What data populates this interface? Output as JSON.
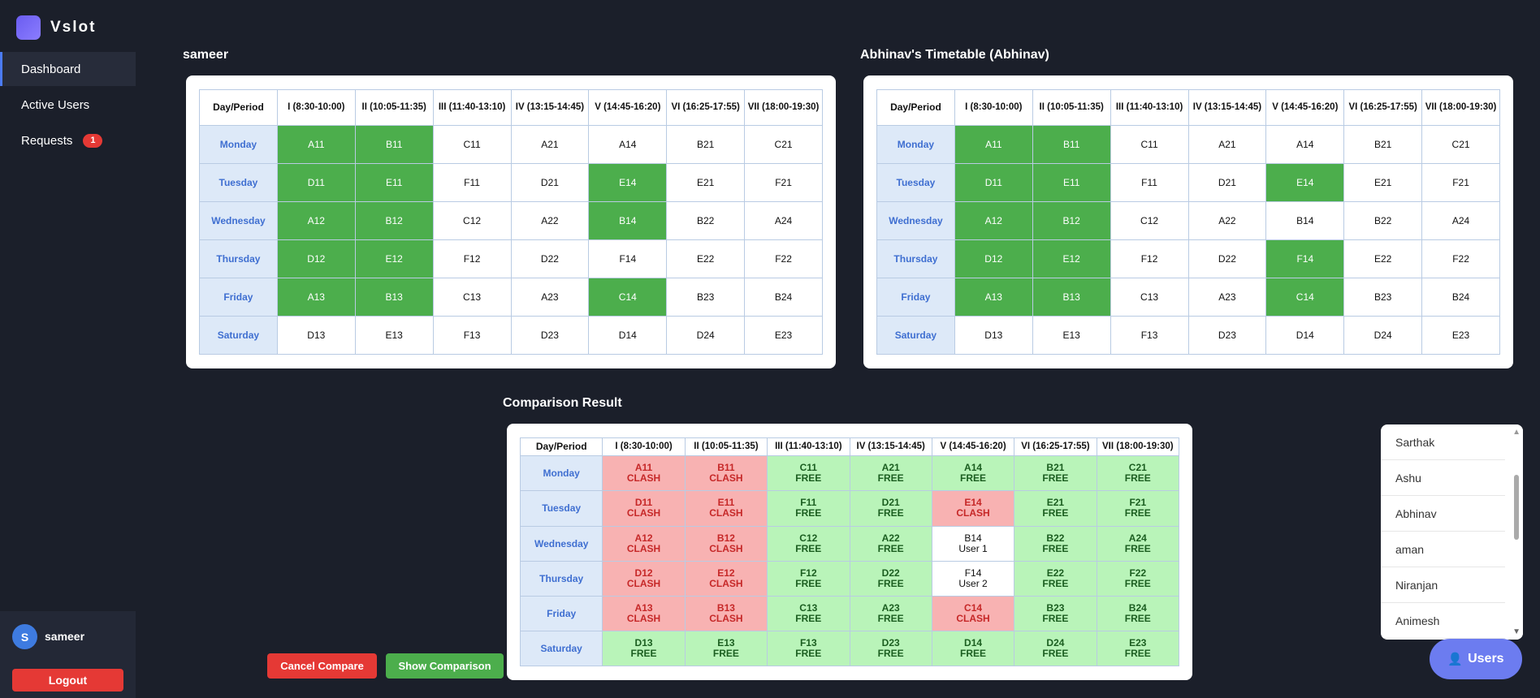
{
  "app": {
    "name": "Vslot"
  },
  "nav": {
    "dashboard": "Dashboard",
    "active_users": "Active Users",
    "requests": "Requests",
    "requests_count": "1"
  },
  "user": {
    "initial": "S",
    "name": "sameer",
    "logout": "Logout"
  },
  "header_cols": [
    "Day/Period",
    "I (8:30-10:00)",
    "II (10:05-11:35)",
    "III (11:40-13:10)",
    "IV (13:15-14:45)",
    "V (14:45-16:20)",
    "VI (16:25-17:55)",
    "VII (18:00-19:30)"
  ],
  "timetable1": {
    "title": "sameer",
    "rows": [
      {
        "day": "Monday",
        "cells": [
          "A11",
          "B11",
          "C11",
          "A21",
          "A14",
          "B21",
          "C21"
        ],
        "hl": [
          1,
          1,
          0,
          0,
          0,
          0,
          0
        ]
      },
      {
        "day": "Tuesday",
        "cells": [
          "D11",
          "E11",
          "F11",
          "D21",
          "E14",
          "E21",
          "F21"
        ],
        "hl": [
          1,
          1,
          0,
          0,
          1,
          0,
          0
        ]
      },
      {
        "day": "Wednesday",
        "cells": [
          "A12",
          "B12",
          "C12",
          "A22",
          "B14",
          "B22",
          "A24"
        ],
        "hl": [
          1,
          1,
          0,
          0,
          1,
          0,
          0
        ]
      },
      {
        "day": "Thursday",
        "cells": [
          "D12",
          "E12",
          "F12",
          "D22",
          "F14",
          "E22",
          "F22"
        ],
        "hl": [
          1,
          1,
          0,
          0,
          0,
          0,
          0
        ]
      },
      {
        "day": "Friday",
        "cells": [
          "A13",
          "B13",
          "C13",
          "A23",
          "C14",
          "B23",
          "B24"
        ],
        "hl": [
          1,
          1,
          0,
          0,
          1,
          0,
          0
        ]
      },
      {
        "day": "Saturday",
        "cells": [
          "D13",
          "E13",
          "F13",
          "D23",
          "D14",
          "D24",
          "E23"
        ],
        "hl": [
          0,
          0,
          0,
          0,
          0,
          0,
          0
        ]
      }
    ]
  },
  "timetable2": {
    "title": "Abhinav's Timetable (Abhinav)",
    "rows": [
      {
        "day": "Monday",
        "cells": [
          "A11",
          "B11",
          "C11",
          "A21",
          "A14",
          "B21",
          "C21"
        ],
        "hl": [
          1,
          1,
          0,
          0,
          0,
          0,
          0
        ]
      },
      {
        "day": "Tuesday",
        "cells": [
          "D11",
          "E11",
          "F11",
          "D21",
          "E14",
          "E21",
          "F21"
        ],
        "hl": [
          1,
          1,
          0,
          0,
          1,
          0,
          0
        ]
      },
      {
        "day": "Wednesday",
        "cells": [
          "A12",
          "B12",
          "C12",
          "A22",
          "B14",
          "B22",
          "A24"
        ],
        "hl": [
          1,
          1,
          0,
          0,
          0,
          0,
          0
        ]
      },
      {
        "day": "Thursday",
        "cells": [
          "D12",
          "E12",
          "F12",
          "D22",
          "F14",
          "E22",
          "F22"
        ],
        "hl": [
          1,
          1,
          0,
          0,
          1,
          0,
          0
        ]
      },
      {
        "day": "Friday",
        "cells": [
          "A13",
          "B13",
          "C13",
          "A23",
          "C14",
          "B23",
          "B24"
        ],
        "hl": [
          1,
          1,
          0,
          0,
          1,
          0,
          0
        ]
      },
      {
        "day": "Saturday",
        "cells": [
          "D13",
          "E13",
          "F13",
          "D23",
          "D14",
          "D24",
          "E23"
        ],
        "hl": [
          0,
          0,
          0,
          0,
          0,
          0,
          0
        ]
      }
    ]
  },
  "comparison": {
    "title": "Comparison Result",
    "rows": [
      {
        "day": "Monday",
        "cells": [
          [
            "A11",
            "CLASH"
          ],
          [
            "B11",
            "CLASH"
          ],
          [
            "C11",
            "FREE"
          ],
          [
            "A21",
            "FREE"
          ],
          [
            "A14",
            "FREE"
          ],
          [
            "B21",
            "FREE"
          ],
          [
            "C21",
            "FREE"
          ]
        ]
      },
      {
        "day": "Tuesday",
        "cells": [
          [
            "D11",
            "CLASH"
          ],
          [
            "E11",
            "CLASH"
          ],
          [
            "F11",
            "FREE"
          ],
          [
            "D21",
            "FREE"
          ],
          [
            "E14",
            "CLASH"
          ],
          [
            "E21",
            "FREE"
          ],
          [
            "F21",
            "FREE"
          ]
        ]
      },
      {
        "day": "Wednesday",
        "cells": [
          [
            "A12",
            "CLASH"
          ],
          [
            "B12",
            "CLASH"
          ],
          [
            "C12",
            "FREE"
          ],
          [
            "A22",
            "FREE"
          ],
          [
            "B14",
            "User 1"
          ],
          [
            "B22",
            "FREE"
          ],
          [
            "A24",
            "FREE"
          ]
        ]
      },
      {
        "day": "Thursday",
        "cells": [
          [
            "D12",
            "CLASH"
          ],
          [
            "E12",
            "CLASH"
          ],
          [
            "F12",
            "FREE"
          ],
          [
            "D22",
            "FREE"
          ],
          [
            "F14",
            "User 2"
          ],
          [
            "E22",
            "FREE"
          ],
          [
            "F22",
            "FREE"
          ]
        ]
      },
      {
        "day": "Friday",
        "cells": [
          [
            "A13",
            "CLASH"
          ],
          [
            "B13",
            "CLASH"
          ],
          [
            "C13",
            "FREE"
          ],
          [
            "A23",
            "FREE"
          ],
          [
            "C14",
            "CLASH"
          ],
          [
            "B23",
            "FREE"
          ],
          [
            "B24",
            "FREE"
          ]
        ]
      },
      {
        "day": "Saturday",
        "cells": [
          [
            "D13",
            "FREE"
          ],
          [
            "E13",
            "FREE"
          ],
          [
            "F13",
            "FREE"
          ],
          [
            "D23",
            "FREE"
          ],
          [
            "D14",
            "FREE"
          ],
          [
            "D24",
            "FREE"
          ],
          [
            "E23",
            "FREE"
          ]
        ]
      }
    ]
  },
  "buttons": {
    "cancel": "Cancel Compare",
    "show": "Show Comparison"
  },
  "users_panel": {
    "items": [
      "Sarthak",
      "Ashu",
      "Abhinav",
      "aman",
      "Niranjan",
      "Animesh"
    ],
    "fab_label": "Users",
    "fab_icon": "user-icon"
  },
  "colors": {
    "clash": "#f8b2b2",
    "free": "#b9f4b9",
    "highlight": "#4cae4c",
    "accent": "#6c7cf0"
  }
}
